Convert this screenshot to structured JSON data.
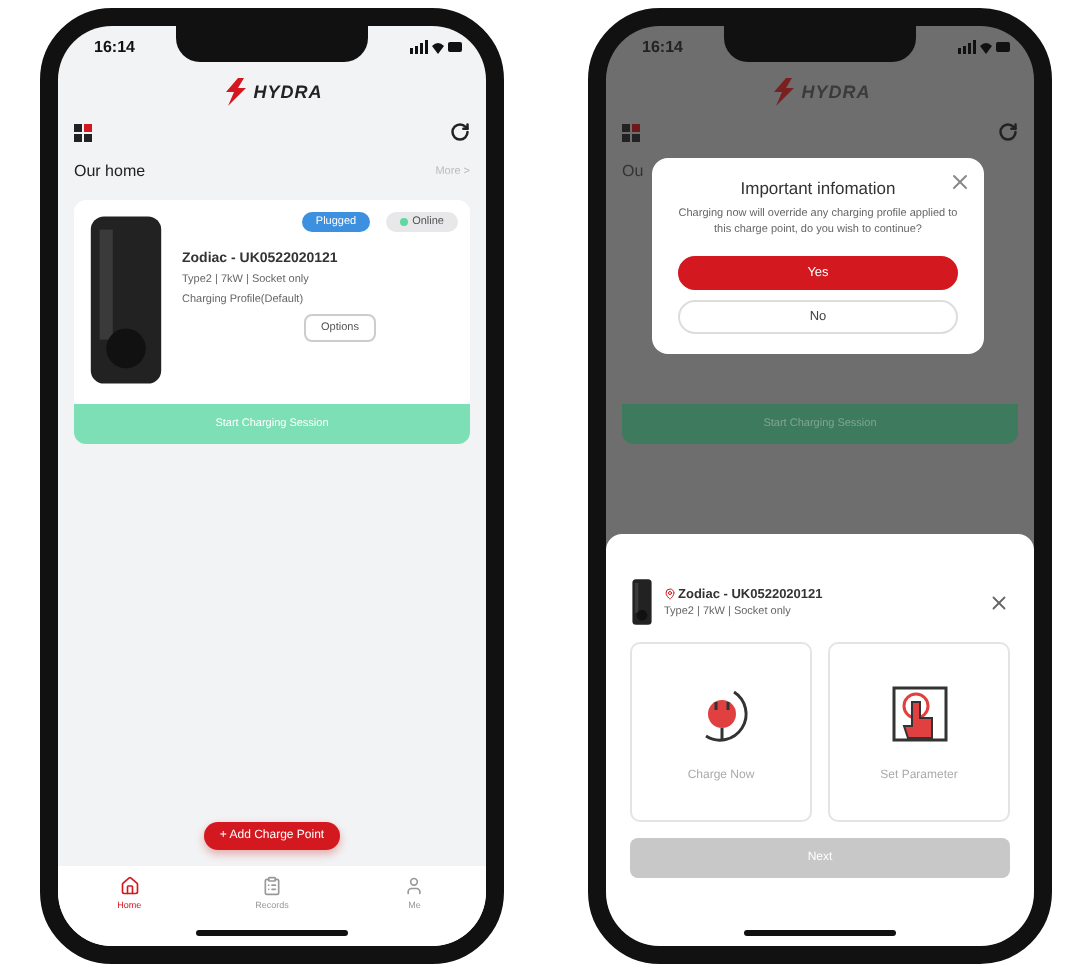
{
  "home_screen": {
    "status_time": "16:14",
    "brand": "HYDRA",
    "section_title": "Our home",
    "more_link": "More >",
    "charger": {
      "badges": [
        {
          "label": "Plugged",
          "kind": "plugged"
        },
        {
          "label": "Online",
          "kind": "online"
        }
      ],
      "name": "Zodiac - UK0522020121",
      "spec": "Type2 | 7kW | Socket only",
      "profile": "Charging Profile(Default)",
      "options_button": "Options"
    },
    "start_button": "Start Charging Session",
    "add_button": "+ Add Charge Point",
    "nav": [
      {
        "label": "Home",
        "kind": "home",
        "selected": true
      },
      {
        "label": "Records",
        "kind": "records",
        "selected": false
      },
      {
        "label": "Me",
        "kind": "me",
        "selected": false
      }
    ]
  },
  "dialog_screen": {
    "status_time": "16:14",
    "brand": "HYDRA",
    "section_title": "Ou",
    "start_button": "Start Charging Session",
    "dialog": {
      "title": "Important infomation",
      "message": "Charging now will override any charging profile applied to this charge point, do you wish to continue?",
      "buttons": [
        {
          "label": "Yes",
          "kind": "primary"
        },
        {
          "label": "No",
          "kind": "secondary"
        }
      ]
    },
    "sheet": {
      "name": "Zodiac - UK0522020121",
      "spec": "Type2 | 7kW | Socket only",
      "options": [
        {
          "label": "Charge Now",
          "kind": "plug",
          "selected": false
        },
        {
          "label": "Set Parameter",
          "kind": "touch",
          "selected": false
        }
      ],
      "next_button": {
        "label": "Next",
        "disabled": true
      }
    }
  }
}
